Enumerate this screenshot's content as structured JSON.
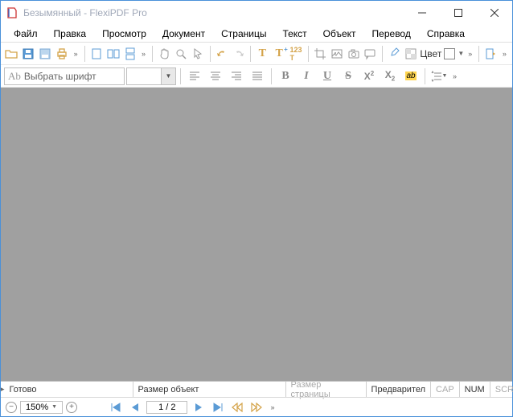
{
  "title": "Безымянный - FlexiPDF Pro",
  "menu": [
    "Файл",
    "Правка",
    "Просмотр",
    "Документ",
    "Страницы",
    "Текст",
    "Объект",
    "Перевод",
    "Справка"
  ],
  "font_placeholder": "Выбрать шрифт",
  "color_label": "Цвет",
  "status": {
    "ready": "Готово",
    "obj_size": "Размер объект",
    "page_size": "Размер страницы",
    "preview": "Предварител",
    "cap": "CAP",
    "num": "NUM",
    "scrl": "SCRL"
  },
  "zoom": "150%",
  "page": "1 / 2",
  "fmt": {
    "B": "B",
    "I": "I",
    "U": "U",
    "S": "S",
    "sup": "X",
    "sub": "X",
    "sup2": "2",
    "sub2": "2",
    "hl": "ab"
  }
}
